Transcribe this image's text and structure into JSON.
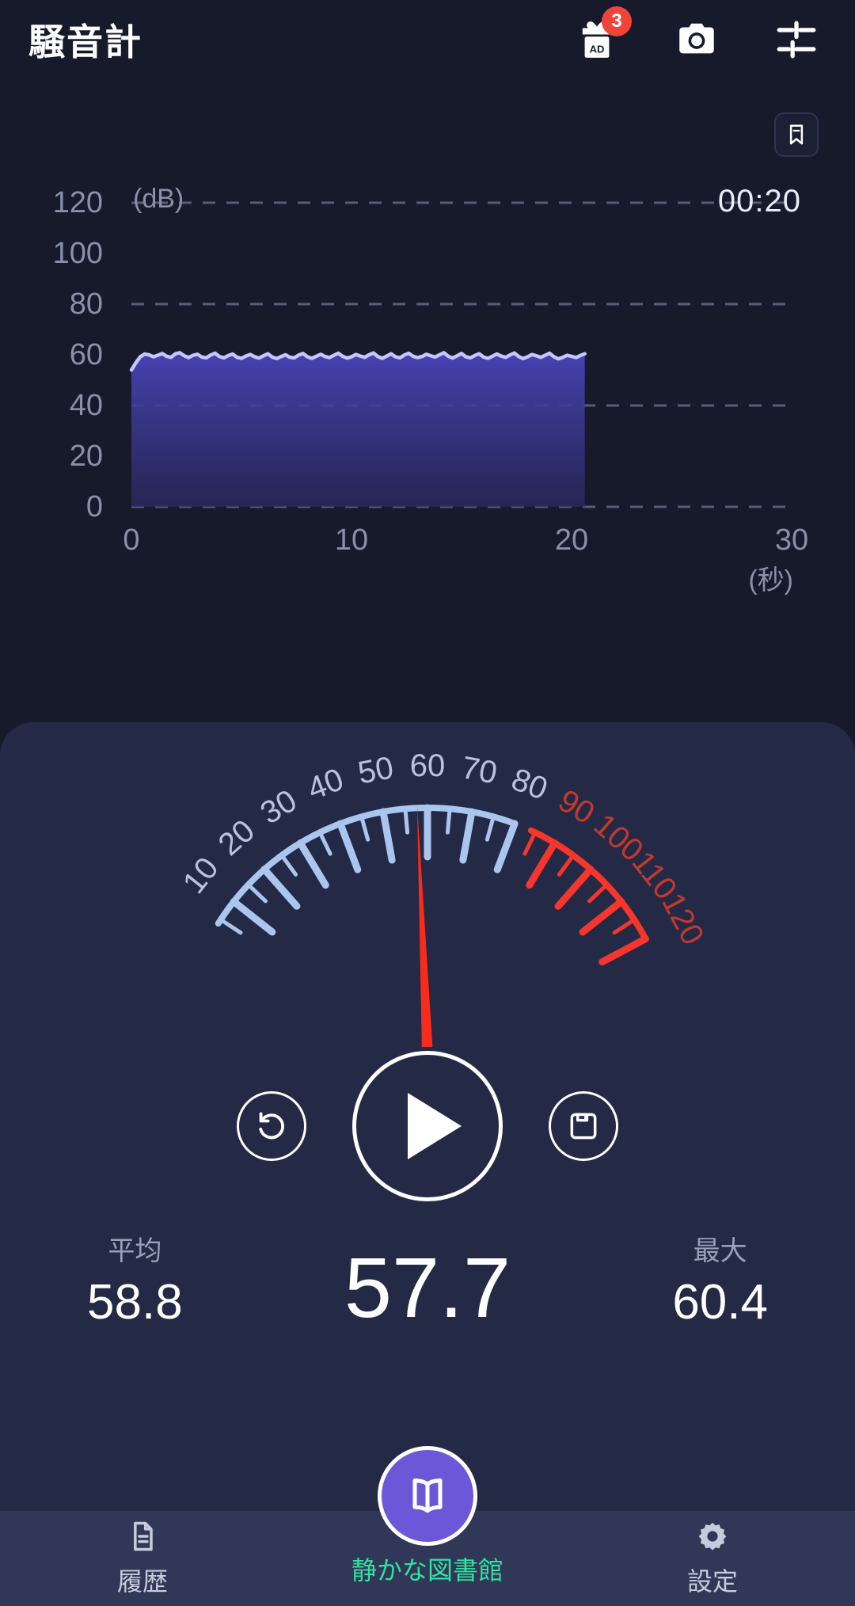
{
  "header": {
    "title": "騒音計",
    "gift_icon": "gift-ad-icon",
    "gift_badge": "3",
    "camera_icon": "camera-icon",
    "settings_icon": "sliders-icon"
  },
  "bookmark": {
    "icon": "bookmark-icon"
  },
  "chart_data": {
    "type": "area",
    "title": "",
    "xlabel": "(秒)",
    "ylabel": "(dB)",
    "timer": "00:20",
    "xlim": [
      0,
      30
    ],
    "ylim": [
      0,
      120
    ],
    "xticks": [
      "0",
      "10",
      "20",
      "30"
    ],
    "yticks": [
      "0",
      "20",
      "40",
      "60",
      "80",
      "100",
      "120"
    ],
    "grid": true,
    "series": [
      {
        "name": "dB",
        "x": [
          0,
          0.2,
          0.4,
          0.6,
          0.8,
          1,
          1.2,
          1.4,
          1.6,
          1.8,
          2,
          2.2,
          2.4,
          2.6,
          2.8,
          3,
          3.2,
          3.4,
          3.6,
          3.8,
          4,
          4.2,
          4.4,
          4.6,
          4.8,
          5,
          5.2,
          5.4,
          5.6,
          5.8,
          6,
          6.2,
          6.4,
          6.6,
          6.8,
          7,
          7.2,
          7.4,
          7.6,
          7.8,
          8,
          8.2,
          8.4,
          8.6,
          8.8,
          9,
          9.2,
          9.4,
          9.6,
          9.8,
          10,
          10.2,
          10.4,
          10.6,
          10.8,
          11,
          11.2,
          11.4,
          11.6,
          11.8,
          12,
          12.2,
          12.4,
          12.6,
          12.8,
          13,
          13.2,
          13.4,
          13.6,
          13.8,
          14,
          14.2,
          14.4,
          14.6,
          14.8,
          15,
          15.2,
          15.4,
          15.6,
          15.8,
          16,
          16.2,
          16.4,
          16.6,
          16.8,
          17,
          17.2,
          17.4,
          17.6,
          17.8,
          18,
          18.2,
          18.4,
          18.6,
          18.8,
          19,
          19.2,
          19.4,
          19.6,
          19.8,
          20,
          20.2,
          20.4,
          20.6
        ],
        "values": [
          54.0,
          56.8,
          59.2,
          60.3,
          60.0,
          59.2,
          59.8,
          60.5,
          59.4,
          59.0,
          60.4,
          60.8,
          59.6,
          58.9,
          59.8,
          60.2,
          59.1,
          58.8,
          59.9,
          60.6,
          59.3,
          58.8,
          59.7,
          60.3,
          59.0,
          58.6,
          59.5,
          60.1,
          59.2,
          58.7,
          59.6,
          60.4,
          59.1,
          58.5,
          59.3,
          60.0,
          59.0,
          58.8,
          59.9,
          60.5,
          59.2,
          58.6,
          59.4,
          60.2,
          59.3,
          58.9,
          59.8,
          60.6,
          59.4,
          58.7,
          59.2,
          60.1,
          59.5,
          59.0,
          60.0,
          60.7,
          59.3,
          58.6,
          59.5,
          60.4,
          59.2,
          58.8,
          59.9,
          60.6,
          59.4,
          58.9,
          59.3,
          60.2,
          59.6,
          59.1,
          60.0,
          60.8,
          59.4,
          58.7,
          59.6,
          60.5,
          59.2,
          58.8,
          59.7,
          60.4,
          59.1,
          58.6,
          59.4,
          60.3,
          59.5,
          59.0,
          59.9,
          60.7,
          59.3,
          58.5,
          59.2,
          60.1,
          59.6,
          59.0,
          59.8,
          60.6,
          59.2,
          58.4,
          59.0,
          59.8,
          59.4,
          58.9,
          59.7,
          60.4,
          59.5,
          58.8,
          58.2
        ]
      }
    ]
  },
  "gauge": {
    "min": 0,
    "max": 120,
    "value": 57.7,
    "labels": [
      "10",
      "20",
      "30",
      "40",
      "50",
      "60",
      "70",
      "80",
      "90",
      "100",
      "110",
      "120"
    ],
    "safe_max": 80,
    "safe_color": "#aac6ef",
    "danger_color": "#f4362c",
    "needle_color": "#fb2b1c"
  },
  "controls": {
    "reset_icon": "reset-icon",
    "play_icon": "play-icon",
    "save_icon": "save-floppy-icon"
  },
  "stats": {
    "average": {
      "label": "平均",
      "value": "58.8"
    },
    "current": {
      "value": "57.7"
    },
    "max": {
      "label": "最大",
      "value": "60.4"
    }
  },
  "navbar": {
    "history": {
      "label": "履歴",
      "icon": "document-icon"
    },
    "center": {
      "label": "静かな図書館",
      "icon": "book-icon",
      "color": "#2fe3a0"
    },
    "settings": {
      "label": "設定",
      "icon": "gear-icon"
    }
  }
}
